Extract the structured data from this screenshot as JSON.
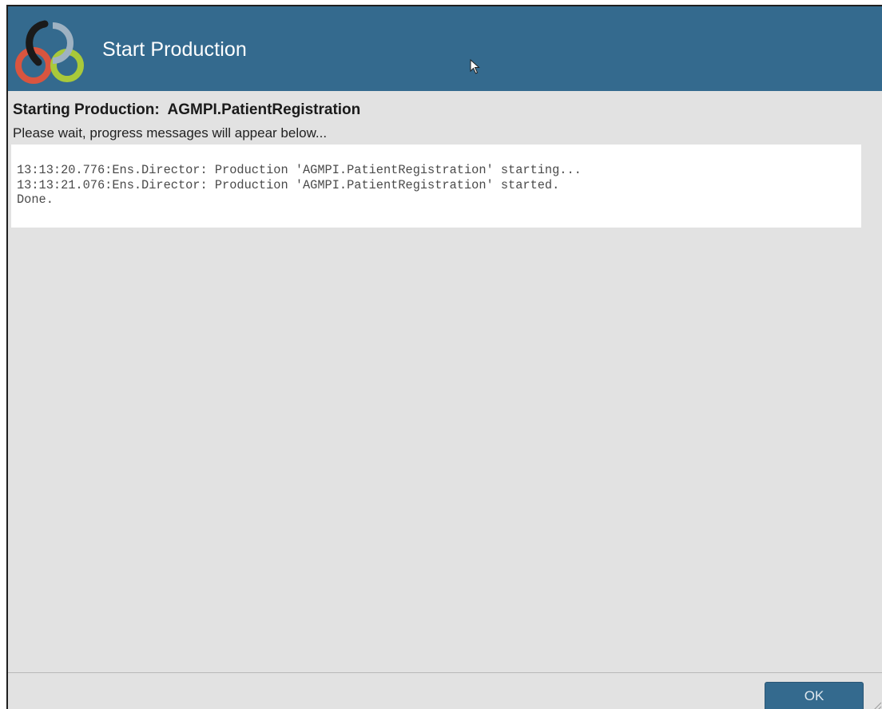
{
  "dialog": {
    "title": "Start Production",
    "logo_icon": "intersystems-rings-logo",
    "header_color": "#346a8e"
  },
  "content": {
    "heading": "Starting Production:  AGMPI.PatientRegistration",
    "subheading": "Please wait, progress messages will appear below..."
  },
  "log": {
    "lines": [
      "13:13:20.776:Ens.Director: Production 'AGMPI.PatientRegistration' starting...",
      "13:13:21.076:Ens.Director: Production 'AGMPI.PatientRegistration' started.",
      "Done."
    ]
  },
  "footer": {
    "ok_label": "OK"
  }
}
